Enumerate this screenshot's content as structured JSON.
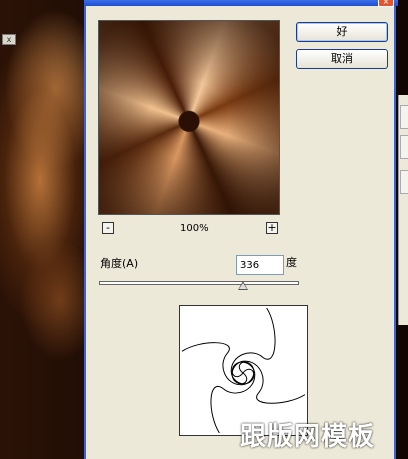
{
  "dialog": {
    "ok_label": "好",
    "cancel_label": "取消",
    "zoom": {
      "minus": "-",
      "plus": "+",
      "level": "100%"
    },
    "angle": {
      "label": "角度(A)",
      "value": "336",
      "unit": "度",
      "slider_fraction": 0.72
    }
  },
  "watermark": "跟版网模板"
}
